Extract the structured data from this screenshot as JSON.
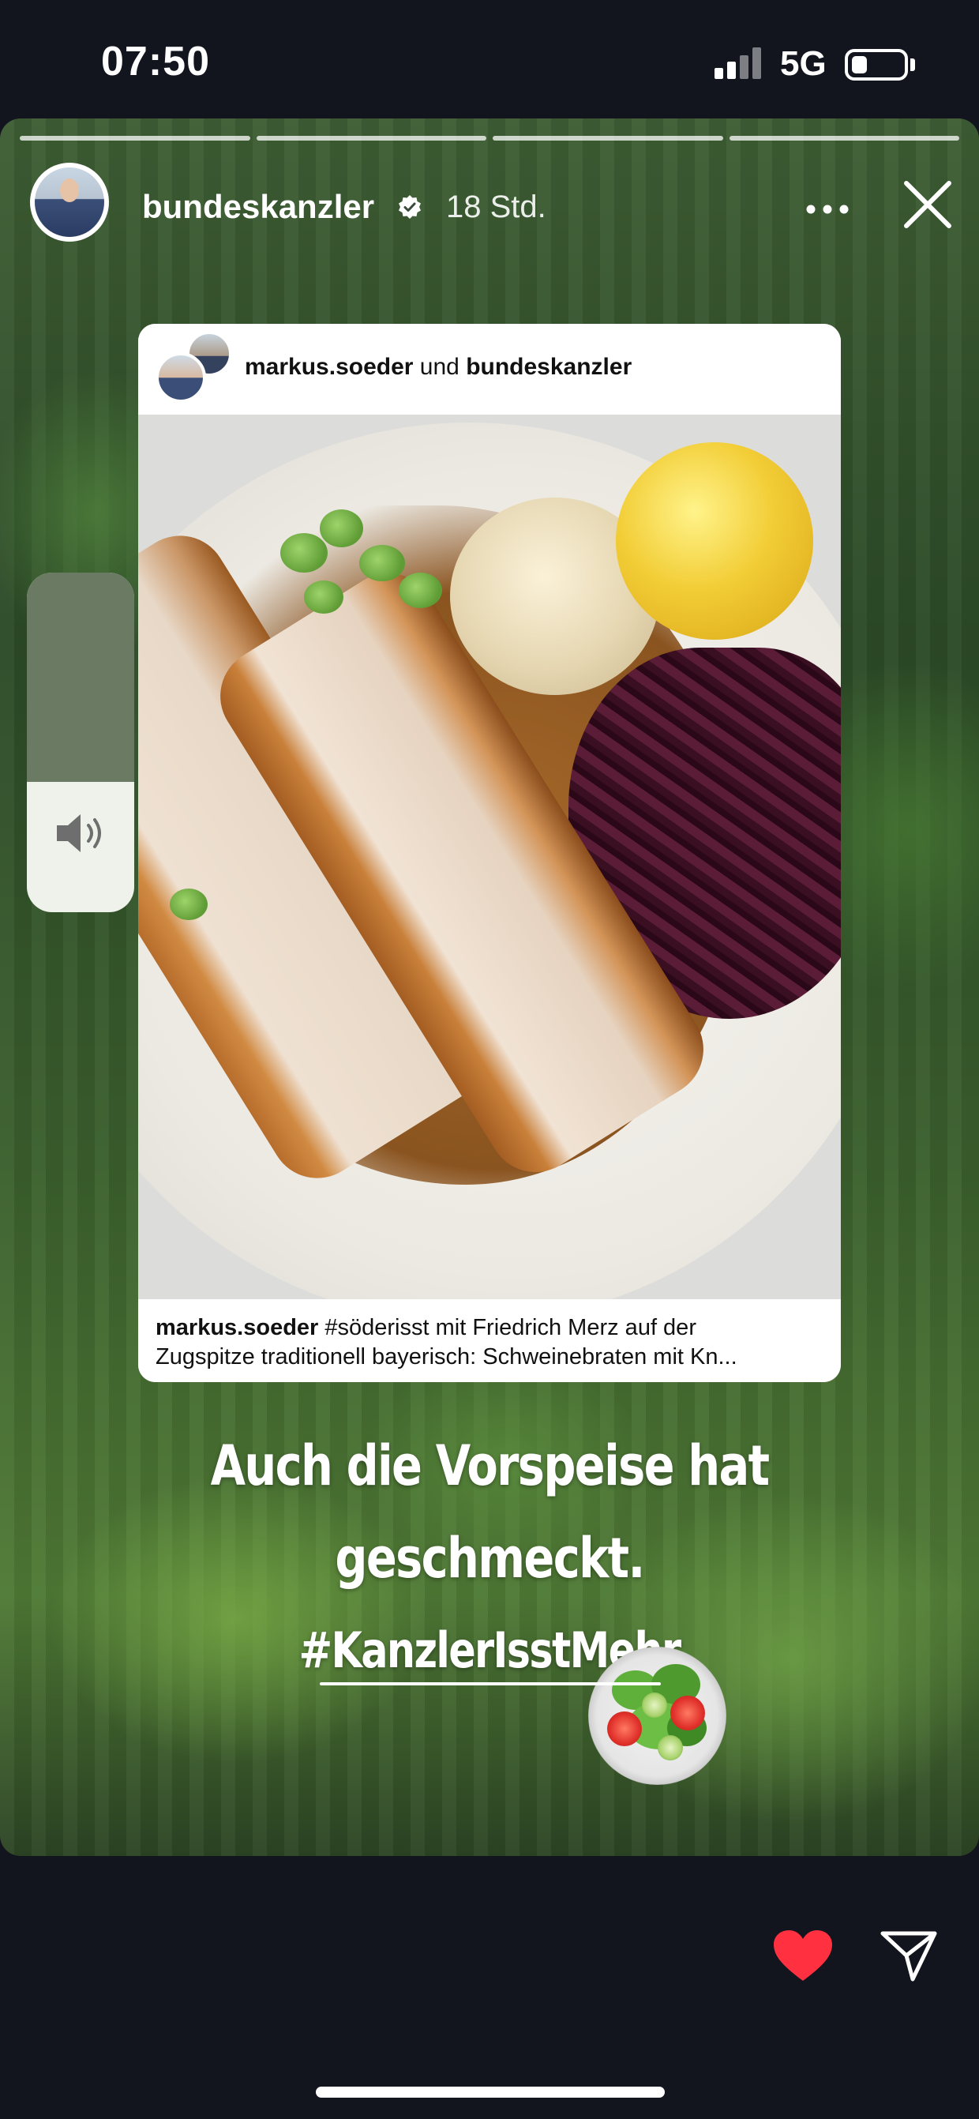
{
  "status_bar": {
    "time": "07:50",
    "network": "5G",
    "battery_level": 0.3
  },
  "story": {
    "segments_total": 4,
    "header": {
      "username": "bundeskanzler",
      "verified": true,
      "time_ago": "18 Std."
    },
    "icons": {
      "more": "more-horizontal-icon",
      "close": "close-icon",
      "volume": "speaker-icon"
    },
    "shared_post": {
      "header_user1": "markus.soeder",
      "header_joiner": " und ",
      "header_user2": "bundeskanzler",
      "caption_user": "markus.soeder",
      "caption_line1": " #söderisst mit Friedrich Merz auf der",
      "caption_line2": "Zugspitze traditionell bayerisch: Schweinebraten mit Kn..."
    },
    "overlay_text": {
      "line1": "Auch die Vorspeise hat",
      "line2": "geschmeckt.",
      "hashtag": "#KanzlerIsstMehr",
      "sticker": "salad-emoji"
    }
  },
  "actions": {
    "like_icon": "heart-icon",
    "like_color": "#ff3040",
    "share_icon": "send-icon"
  },
  "colors": {
    "background": "#12141e",
    "volume_track": "#6a7a63"
  }
}
